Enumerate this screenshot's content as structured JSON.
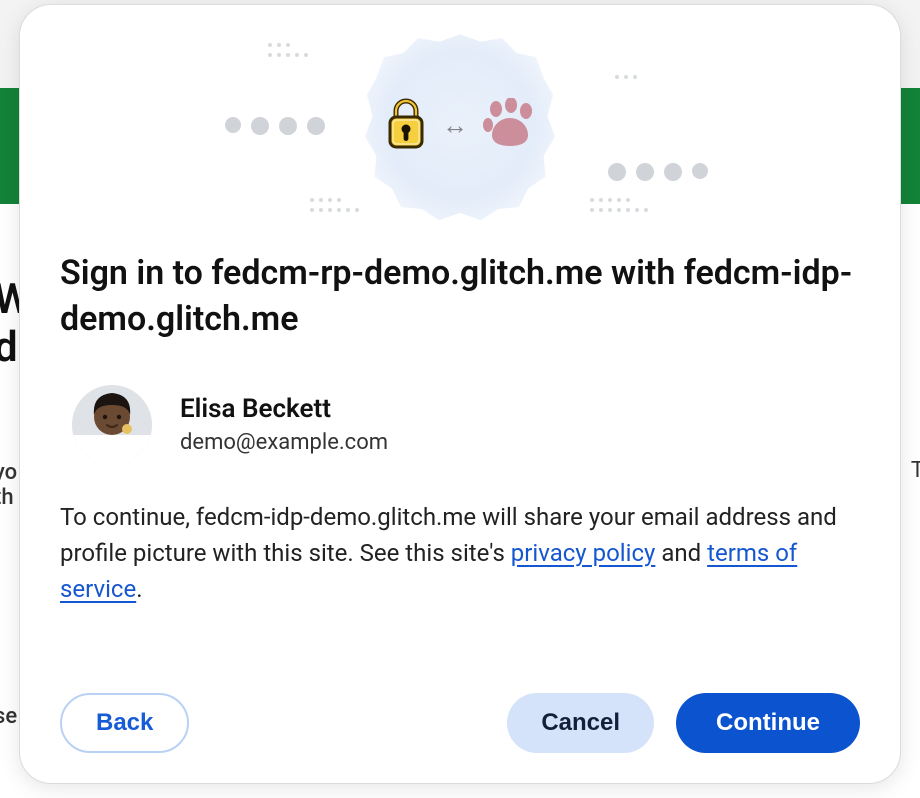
{
  "dialog": {
    "title": "Sign in to fedcm-rp-demo.glitch.me with fedcm-idp-demo.glitch.me",
    "account": {
      "name": "Elisa Beckett",
      "email": "demo@example.com"
    },
    "disclosure": {
      "prefix": "To continue, fedcm-idp-demo.glitch.me will share your email address and profile picture with this site. See this site's ",
      "privacy_link": "privacy policy",
      "connector": " and ",
      "terms_link": "terms of service",
      "suffix": "."
    },
    "buttons": {
      "back": "Back",
      "cancel": "Cancel",
      "continue": "Continue"
    },
    "illustration": {
      "left_icon": "lock-icon",
      "arrow": "↔",
      "right_icon": "paw-icon"
    }
  },
  "background_fragments": {
    "h1": "We do",
    "p1": "yo th",
    "p2": "se",
    "r1": "T"
  },
  "colors": {
    "brand_green": "#138338",
    "link_blue": "#1557d0",
    "primary_button": "#0c53cf",
    "secondary_button_bg": "#d4e2fa",
    "outline_button_border": "#b9d1f5"
  }
}
